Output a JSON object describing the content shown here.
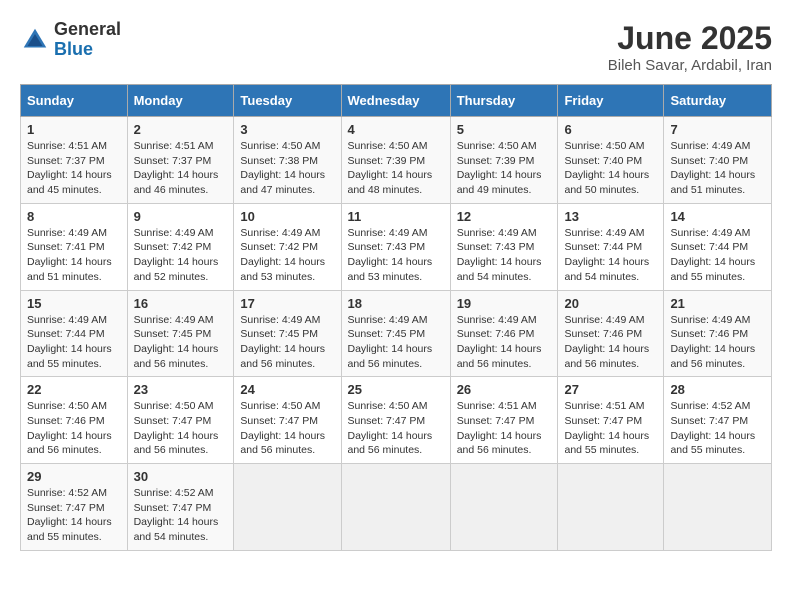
{
  "logo": {
    "general": "General",
    "blue": "Blue"
  },
  "title": "June 2025",
  "location": "Bileh Savar, Ardabil, Iran",
  "days_of_week": [
    "Sunday",
    "Monday",
    "Tuesday",
    "Wednesday",
    "Thursday",
    "Friday",
    "Saturday"
  ],
  "weeks": [
    [
      {
        "day": 1,
        "sunrise": "4:51 AM",
        "sunset": "7:37 PM",
        "daylight": "14 hours and 45 minutes."
      },
      {
        "day": 2,
        "sunrise": "4:51 AM",
        "sunset": "7:37 PM",
        "daylight": "14 hours and 46 minutes."
      },
      {
        "day": 3,
        "sunrise": "4:50 AM",
        "sunset": "7:38 PM",
        "daylight": "14 hours and 47 minutes."
      },
      {
        "day": 4,
        "sunrise": "4:50 AM",
        "sunset": "7:39 PM",
        "daylight": "14 hours and 48 minutes."
      },
      {
        "day": 5,
        "sunrise": "4:50 AM",
        "sunset": "7:39 PM",
        "daylight": "14 hours and 49 minutes."
      },
      {
        "day": 6,
        "sunrise": "4:50 AM",
        "sunset": "7:40 PM",
        "daylight": "14 hours and 50 minutes."
      },
      {
        "day": 7,
        "sunrise": "4:49 AM",
        "sunset": "7:40 PM",
        "daylight": "14 hours and 51 minutes."
      }
    ],
    [
      {
        "day": 8,
        "sunrise": "4:49 AM",
        "sunset": "7:41 PM",
        "daylight": "14 hours and 51 minutes."
      },
      {
        "day": 9,
        "sunrise": "4:49 AM",
        "sunset": "7:42 PM",
        "daylight": "14 hours and 52 minutes."
      },
      {
        "day": 10,
        "sunrise": "4:49 AM",
        "sunset": "7:42 PM",
        "daylight": "14 hours and 53 minutes."
      },
      {
        "day": 11,
        "sunrise": "4:49 AM",
        "sunset": "7:43 PM",
        "daylight": "14 hours and 53 minutes."
      },
      {
        "day": 12,
        "sunrise": "4:49 AM",
        "sunset": "7:43 PM",
        "daylight": "14 hours and 54 minutes."
      },
      {
        "day": 13,
        "sunrise": "4:49 AM",
        "sunset": "7:44 PM",
        "daylight": "14 hours and 54 minutes."
      },
      {
        "day": 14,
        "sunrise": "4:49 AM",
        "sunset": "7:44 PM",
        "daylight": "14 hours and 55 minutes."
      }
    ],
    [
      {
        "day": 15,
        "sunrise": "4:49 AM",
        "sunset": "7:44 PM",
        "daylight": "14 hours and 55 minutes."
      },
      {
        "day": 16,
        "sunrise": "4:49 AM",
        "sunset": "7:45 PM",
        "daylight": "14 hours and 56 minutes."
      },
      {
        "day": 17,
        "sunrise": "4:49 AM",
        "sunset": "7:45 PM",
        "daylight": "14 hours and 56 minutes."
      },
      {
        "day": 18,
        "sunrise": "4:49 AM",
        "sunset": "7:45 PM",
        "daylight": "14 hours and 56 minutes."
      },
      {
        "day": 19,
        "sunrise": "4:49 AM",
        "sunset": "7:46 PM",
        "daylight": "14 hours and 56 minutes."
      },
      {
        "day": 20,
        "sunrise": "4:49 AM",
        "sunset": "7:46 PM",
        "daylight": "14 hours and 56 minutes."
      },
      {
        "day": 21,
        "sunrise": "4:49 AM",
        "sunset": "7:46 PM",
        "daylight": "14 hours and 56 minutes."
      }
    ],
    [
      {
        "day": 22,
        "sunrise": "4:50 AM",
        "sunset": "7:46 PM",
        "daylight": "14 hours and 56 minutes."
      },
      {
        "day": 23,
        "sunrise": "4:50 AM",
        "sunset": "7:47 PM",
        "daylight": "14 hours and 56 minutes."
      },
      {
        "day": 24,
        "sunrise": "4:50 AM",
        "sunset": "7:47 PM",
        "daylight": "14 hours and 56 minutes."
      },
      {
        "day": 25,
        "sunrise": "4:50 AM",
        "sunset": "7:47 PM",
        "daylight": "14 hours and 56 minutes."
      },
      {
        "day": 26,
        "sunrise": "4:51 AM",
        "sunset": "7:47 PM",
        "daylight": "14 hours and 56 minutes."
      },
      {
        "day": 27,
        "sunrise": "4:51 AM",
        "sunset": "7:47 PM",
        "daylight": "14 hours and 55 minutes."
      },
      {
        "day": 28,
        "sunrise": "4:52 AM",
        "sunset": "7:47 PM",
        "daylight": "14 hours and 55 minutes."
      }
    ],
    [
      {
        "day": 29,
        "sunrise": "4:52 AM",
        "sunset": "7:47 PM",
        "daylight": "14 hours and 55 minutes."
      },
      {
        "day": 30,
        "sunrise": "4:52 AM",
        "sunset": "7:47 PM",
        "daylight": "14 hours and 54 minutes."
      },
      null,
      null,
      null,
      null,
      null
    ]
  ]
}
